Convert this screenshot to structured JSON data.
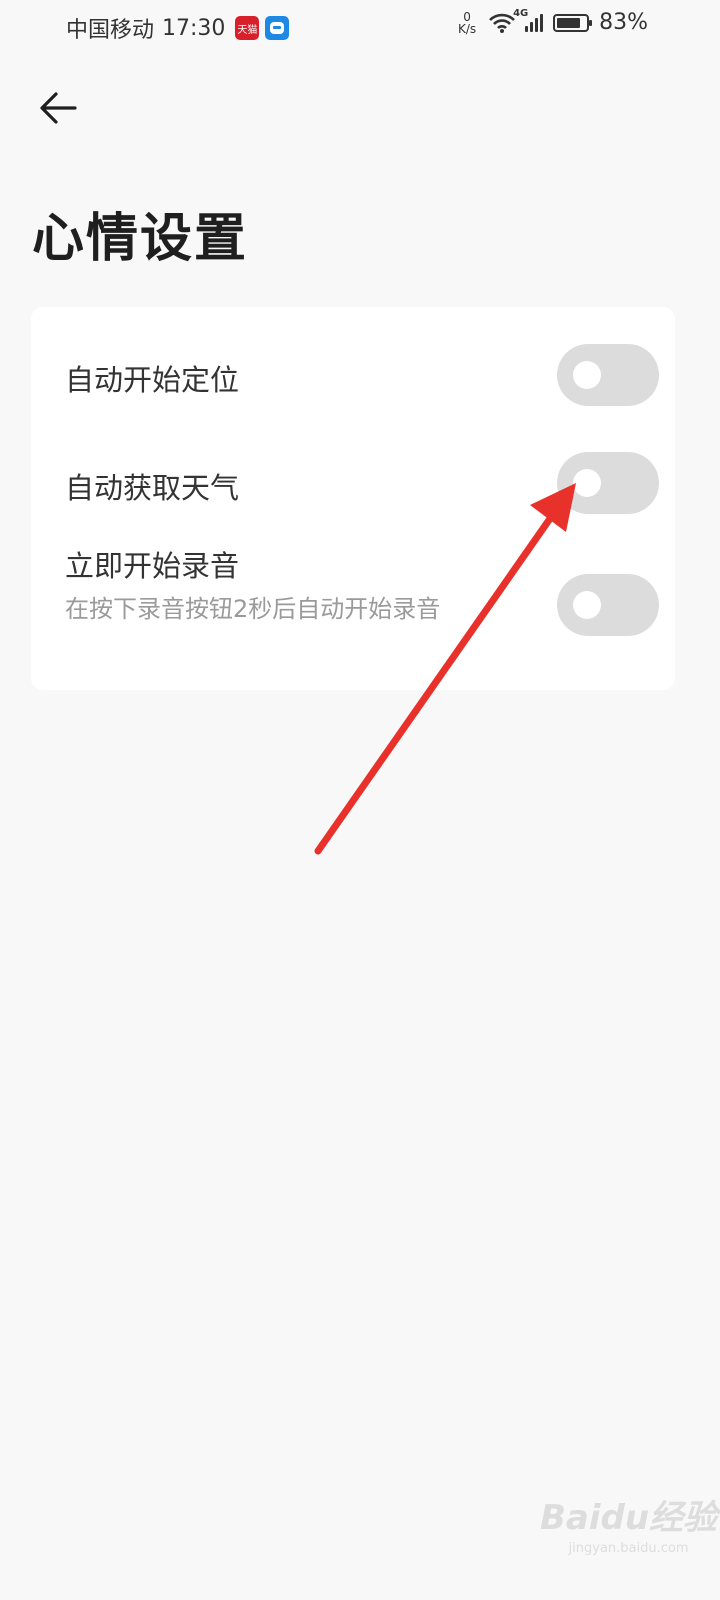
{
  "status_bar": {
    "carrier": "中国移动",
    "time": "17:30",
    "app1": "天猫",
    "speed_top": "0",
    "speed_bottom": "K/s",
    "network": "4G",
    "battery_pct": "83%",
    "battery_level": 0.83
  },
  "header": {
    "back_icon": "arrow-left-icon",
    "title": "心情设置"
  },
  "settings": [
    {
      "label": "自动开始定位",
      "subtitle": "",
      "enabled": false
    },
    {
      "label": "自动获取天气",
      "subtitle": "",
      "enabled": false
    },
    {
      "label": "立即开始录音",
      "subtitle": "在按下录音按钮2秒后自动开始录音",
      "enabled": false
    }
  ],
  "annotation": {
    "color": "#e8312a"
  },
  "watermark": {
    "logo": "Baidu经验",
    "url": "jingyan.baidu.com"
  }
}
